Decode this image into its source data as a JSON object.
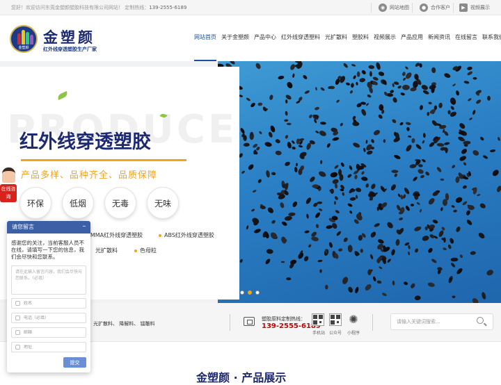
{
  "topbar": {
    "welcome": "您好！欢迎访问东莞金塑颜塑胶科技有限公司网站！ 定制热线：",
    "phone": "139-2555-6189",
    "links": [
      {
        "label": "网站地图",
        "icon": "map-icon"
      },
      {
        "label": "合作客户",
        "icon": "user-icon"
      },
      {
        "label": "视频展示",
        "icon": "play-icon"
      }
    ]
  },
  "brand": {
    "name": "金塑颜",
    "slogan": "红外线穿透塑胶生产厂家",
    "badge_text": "金塑颜",
    "badge_colors": [
      "#d62a2a",
      "#f1c40f",
      "#2ecc71",
      "#9b59b6",
      "#e67e22"
    ]
  },
  "nav": {
    "items": [
      "网站首页",
      "关于金塑颜",
      "产品中心",
      "红外线穿透塑料",
      "光扩散料",
      "塑胶料",
      "视频展示",
      "产品应用",
      "新闻资讯",
      "在线留言",
      "联系我们"
    ],
    "active": 0
  },
  "hero": {
    "watermark": "PRODUCE",
    "title": "红外线穿透塑胶",
    "subtitle": "产品多样、品种齐全、品质保障",
    "features": [
      "环保",
      "低烟",
      "无毒",
      "无味"
    ],
    "products_row1": [
      "PMMA红外线穿透塑胶",
      "ABS红外线穿透塑胶"
    ],
    "products_row2": [
      "光扩散料",
      "色母粒"
    ],
    "slides": 3,
    "active_slide": 1
  },
  "side_float": {
    "label": "在线咨询"
  },
  "bar": {
    "categories": "光扩散料、 降解料、 镭雕料",
    "hotline_label": "塑胶原料定制热线：",
    "hotline_number": "139-2555-6189",
    "qr_labels": [
      "手机站",
      "公众号",
      "小程序"
    ],
    "search_placeholder": "请输入关键词搜索..."
  },
  "section_title": "金塑颜 · 产品展示",
  "chat": {
    "title": "请您留言",
    "message": "感谢您的关注，当前客服人员不在线，请填写一下您的信息，我们会尽快和您联系。",
    "textarea_placeholder": "请在此输入留言内容，我们会尽快与您联系。（必填）",
    "fields": [
      {
        "placeholder": "姓名",
        "icon": "person-icon"
      },
      {
        "placeholder": "电话（必填）",
        "icon": "phone-icon"
      },
      {
        "placeholder": "邮箱",
        "icon": "mail-icon"
      },
      {
        "placeholder": "地址",
        "icon": "location-icon"
      }
    ],
    "submit": "提交"
  },
  "colors": {
    "primary": "#1d2a73",
    "accent": "#f2a31a",
    "nav_active": "#1a50a0",
    "hotline": "#cc0000"
  }
}
